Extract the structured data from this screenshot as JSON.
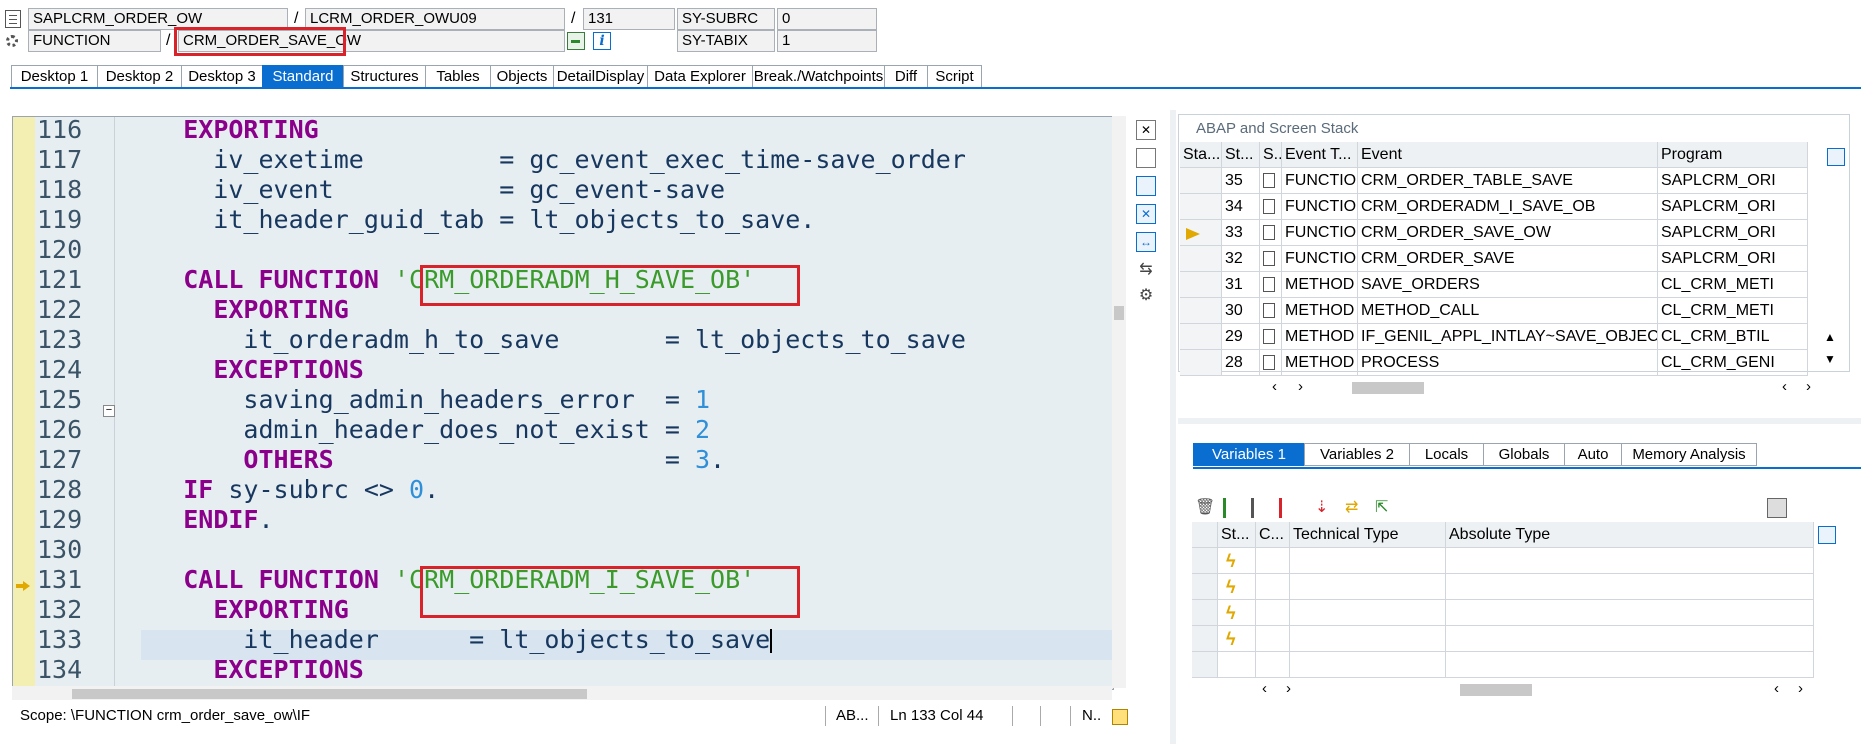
{
  "top_fields": {
    "program": "SAPLCRM_ORDER_OW",
    "include": "LCRM_ORDER_OWU09",
    "line": "131",
    "var1_name": "SY-SUBRC",
    "var1_value": "0",
    "type": "FUNCTION",
    "function_name": "CRM_ORDER_SAVE_OW",
    "var2_name": "SY-TABIX",
    "var2_value": "1",
    "sep": "/"
  },
  "tabs": [
    "Desktop 1",
    "Desktop 2",
    "Desktop 3",
    "Standard",
    "Structures",
    "Tables",
    "Objects",
    "DetailDisplay",
    "Data Explorer",
    "Break./Watchpoints",
    "Diff",
    "Script"
  ],
  "active_tab": "Standard",
  "code": [
    {
      "n": "116",
      "t": "    EXPORTING"
    },
    {
      "n": "117",
      "t": "      iv_exetime         = gc_event_exec_time-save_order"
    },
    {
      "n": "118",
      "t": "      iv_event           = gc_event-save"
    },
    {
      "n": "119",
      "t": "      it_header_guid_tab = lt_objects_to_save."
    },
    {
      "n": "120",
      "t": ""
    },
    {
      "n": "121",
      "t": "    CALL FUNCTION 'CRM_ORDERADM_H_SAVE_OB'"
    },
    {
      "n": "122",
      "t": "      EXPORTING"
    },
    {
      "n": "123",
      "t": "        it_orderadm_h_to_save       = lt_objects_to_save"
    },
    {
      "n": "124",
      "t": "      EXCEPTIONS"
    },
    {
      "n": "125",
      "t": "        saving_admin_headers_error  = 1"
    },
    {
      "n": "126",
      "t": "        admin_header_does_not_exist = 2"
    },
    {
      "n": "127",
      "t": "        OTHERS                      = 3."
    },
    {
      "n": "128",
      "t": "    IF sy-subrc <> 0."
    },
    {
      "n": "129",
      "t": "    ENDIF."
    },
    {
      "n": "130",
      "t": ""
    },
    {
      "n": "131",
      "t": "    CALL FUNCTION 'CRM_ORDERADM_I_SAVE_OB'"
    },
    {
      "n": "132",
      "t": "      EXPORTING"
    },
    {
      "n": "133",
      "t": "        it_header      = lt_objects_to_save"
    },
    {
      "n": "134",
      "t": "      EXCEPTIONS"
    }
  ],
  "code_tokens": {
    "keywords": [
      "EXPORTING",
      "CALL",
      "FUNCTION",
      "EXCEPTIONS",
      "IF",
      "ENDIF.",
      "ENDIF",
      "OTHERS"
    ]
  },
  "status_bar": {
    "scope": "Scope: \\FUNCTION crm_order_save_ow\\IF",
    "lang": "AB...",
    "position": "Ln 133 Col  44",
    "mode": "N.."
  },
  "stack": {
    "title": "ABAP and Screen Stack",
    "headers": [
      "Sta...",
      "St...",
      "S...",
      "Event T...",
      "Event",
      "Program"
    ],
    "rows": [
      {
        "level": "35",
        "type": "FUNCTIO...",
        "event": "CRM_ORDER_TABLE_SAVE",
        "program": "SAPLCRM_ORI"
      },
      {
        "level": "34",
        "type": "FUNCTIO...",
        "event": "CRM_ORDERADM_I_SAVE_OB",
        "program": "SAPLCRM_ORI"
      },
      {
        "level": "33",
        "type": "FUNCTIO...",
        "event": "CRM_ORDER_SAVE_OW",
        "program": "SAPLCRM_ORI",
        "current": true
      },
      {
        "level": "32",
        "type": "FUNCTIO...",
        "event": "CRM_ORDER_SAVE",
        "program": "SAPLCRM_ORI"
      },
      {
        "level": "31",
        "type": "METHOD",
        "event": "SAVE_ORDERS",
        "program": "CL_CRM_METI"
      },
      {
        "level": "30",
        "type": "METHOD",
        "event": "METHOD_CALL",
        "program": "CL_CRM_METI"
      },
      {
        "level": "29",
        "type": "METHOD",
        "event": "IF_GENIL_APPL_INTLAY~SAVE_OBJECTS",
        "program": "CL_CRM_BTIL"
      },
      {
        "level": "28",
        "type": "METHOD",
        "event": "PROCESS",
        "program": "CL_CRM_GENI"
      }
    ]
  },
  "var_tabs": [
    "Variables 1",
    "Variables 2",
    "Locals",
    "Globals",
    "Auto",
    "Memory Analysis"
  ],
  "active_var_tab": "Variables 1",
  "var_table": {
    "headers": [
      "St...",
      "C...",
      "Technical Type",
      "Absolute Type"
    ],
    "row_count": 4
  },
  "colors": {
    "accent": "#0a6ed1",
    "highlight_box": "#d8232a",
    "keyword": "#8b008b",
    "string": "#3a9a2a",
    "number": "#2f8fd8"
  }
}
